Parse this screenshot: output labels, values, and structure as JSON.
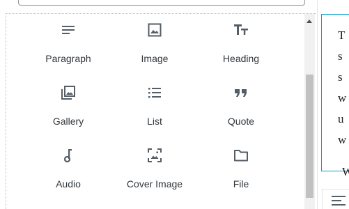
{
  "inserter": {
    "blocks": [
      {
        "label": "Paragraph",
        "icon": "paragraph-icon"
      },
      {
        "label": "Image",
        "icon": "image-icon"
      },
      {
        "label": "Heading",
        "icon": "heading-icon"
      },
      {
        "label": "Gallery",
        "icon": "gallery-icon"
      },
      {
        "label": "List",
        "icon": "list-icon"
      },
      {
        "label": "Quote",
        "icon": "quote-icon"
      },
      {
        "label": "Audio",
        "icon": "audio-icon"
      },
      {
        "label": "Cover Image",
        "icon": "cover-image-icon"
      },
      {
        "label": "File",
        "icon": "file-icon"
      }
    ]
  },
  "editor": {
    "paragraph_line_starts": [
      "T",
      "s",
      "s",
      "w",
      "u",
      "w"
    ],
    "next_paragraph_start": "W",
    "toolbar_icon": "align-left-icon"
  },
  "colors": {
    "selection_border": "#00a0d2",
    "icon": "#555d66",
    "label": "#32373c",
    "scrollbar_thumb": "#c1c1c1"
  }
}
